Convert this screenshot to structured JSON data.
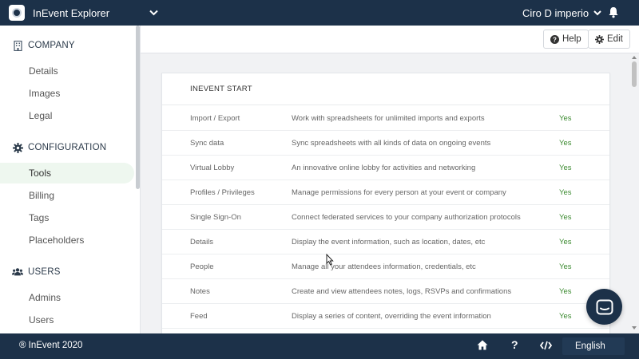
{
  "header": {
    "app_name": "InEvent Explorer",
    "user_name": "Ciro D imperio",
    "logo_icon": "inevent-logo-icon",
    "colors": {
      "bar": "#1c3149"
    }
  },
  "sidebar": {
    "sections": [
      {
        "label": "COMPANY",
        "icon": "building-icon",
        "items": [
          "Details",
          "Images",
          "Legal"
        ]
      },
      {
        "label": "CONFIGURATION",
        "icon": "gear-icon",
        "items": [
          "Tools",
          "Billing",
          "Tags",
          "Placeholders"
        ]
      },
      {
        "label": "USERS",
        "icon": "users-icon",
        "items": [
          "Admins",
          "Users"
        ]
      }
    ],
    "active_item": "Tools"
  },
  "toolbar": {
    "help_label": "Help",
    "edit_label": "Edit"
  },
  "main": {
    "card_title": "INEVENT START",
    "rows": [
      {
        "name": "Import / Export",
        "description": "Work with spreadsheets for unlimited imports and exports",
        "status": "Yes"
      },
      {
        "name": "Sync data",
        "description": "Sync spreadsheets with all kinds of data on ongoing events",
        "status": "Yes"
      },
      {
        "name": "Virtual Lobby",
        "description": "An innovative online lobby for activities and networking",
        "status": "Yes"
      },
      {
        "name": "Profiles / Privileges",
        "description": "Manage permissions for every person at your event or company",
        "status": "Yes"
      },
      {
        "name": "Single Sign-On",
        "description": "Connect federated services to your company authorization protocols",
        "status": "Yes"
      },
      {
        "name": "Details",
        "description": "Display the event information, such as location, dates, etc",
        "status": "Yes"
      },
      {
        "name": "People",
        "description": "Manage all your attendees information, credentials, etc",
        "status": "Yes"
      },
      {
        "name": "Notes",
        "description": "Create and view attendees notes, logs, RSVPs and confirmations",
        "status": "Yes"
      },
      {
        "name": "Feed",
        "description": "Display a series of content, overriding the event information",
        "status": "Yes"
      }
    ],
    "status_color": "#3b8a2f"
  },
  "footer": {
    "copyright": "® InEvent 2020",
    "language": "English",
    "icons": [
      "home-icon",
      "question-icon",
      "code-icon"
    ]
  }
}
